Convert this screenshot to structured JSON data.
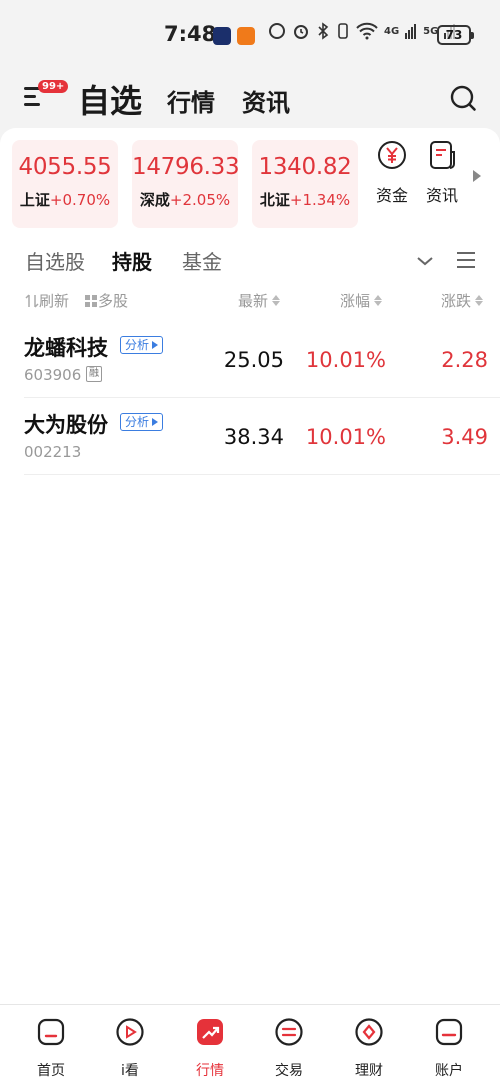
{
  "status": {
    "time": "7:48",
    "network": "4G",
    "network2": "5G",
    "battery": "73"
  },
  "header": {
    "badge": "99+",
    "tabs": [
      "自选",
      "行情",
      "资讯"
    ]
  },
  "indices": [
    {
      "value": "4055.55",
      "name": "上证",
      "change": "+0.70%"
    },
    {
      "value": "14796.33",
      "name": "深成",
      "change": "+2.05%"
    },
    {
      "value": "1340.82",
      "name": "北证",
      "change": "+1.34%"
    }
  ],
  "quick_links": [
    {
      "label": "资金",
      "icon": "yuan-icon"
    },
    {
      "label": "资讯",
      "icon": "document-icon"
    }
  ],
  "sub_tabs": [
    "自选股",
    "持股",
    "基金"
  ],
  "active_sub_tab": "持股",
  "columns": {
    "refresh": "刷新",
    "multi": "多股",
    "latest": "最新",
    "change_pct": "涨幅",
    "change_amt": "涨跌"
  },
  "analyze_label": "分析",
  "margin_label": "融",
  "stocks": [
    {
      "name": "龙蟠科技",
      "code": "603906",
      "margin": true,
      "price": "25.05",
      "pct": "10.01%",
      "chg": "2.28"
    },
    {
      "name": "大为股份",
      "code": "002213",
      "margin": false,
      "price": "38.34",
      "pct": "10.01%",
      "chg": "3.49"
    }
  ],
  "bottom_nav": [
    {
      "label": "首页",
      "icon": "home-icon"
    },
    {
      "label": "i看",
      "icon": "play-icon"
    },
    {
      "label": "行情",
      "icon": "trend-icon"
    },
    {
      "label": "交易",
      "icon": "exchange-icon"
    },
    {
      "label": "理财",
      "icon": "wealth-icon"
    },
    {
      "label": "账户",
      "icon": "account-icon"
    }
  ],
  "colors": {
    "accent": "#e5323a",
    "rise": "#e0353b",
    "link": "#3b7de0"
  }
}
